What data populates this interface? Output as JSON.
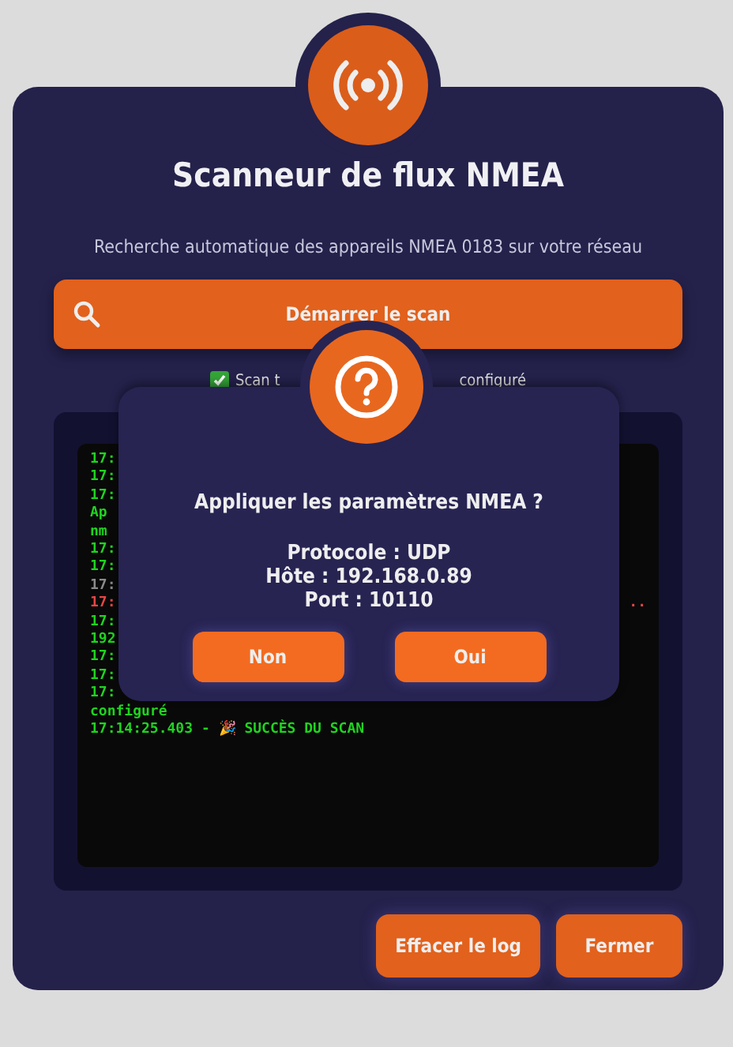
{
  "scanner": {
    "title": "Scanneur de flux NMEA",
    "subtitle": "Recherche automatique des appareils NMEA 0183 sur votre réseau",
    "scan_button": "Démarrer le scan",
    "option": {
      "checked": true,
      "label_start": "Scan t",
      "label_end": "configuré"
    },
    "log": [
      {
        "text": "17:",
        "kind": "ok"
      },
      {
        "text": "17:",
        "kind": "ok"
      },
      {
        "text": "17:",
        "kind": "ok"
      },
      {
        "text": "Ap",
        "kind": "ok"
      },
      {
        "text": "nm",
        "kind": "ok"
      },
      {
        "text": "17:",
        "kind": "ok"
      },
      {
        "text": "17:",
        "kind": "ok"
      },
      {
        "text": "17:",
        "kind": "muted"
      },
      {
        "text": "17:",
        "kind": "error",
        "tail": ".."
      },
      {
        "text": "17:",
        "kind": "ok"
      },
      {
        "text": "192",
        "kind": "ok"
      },
      {
        "text": "17:",
        "kind": "ok"
      },
      {
        "text": "17:",
        "kind": "ok"
      },
      {
        "text": "17:",
        "kind": "ok"
      },
      {
        "text": "configuré",
        "kind": "ok"
      },
      {
        "text": "17:14:25.403 - 🎉 SUCCÈS DU SCAN",
        "kind": "ok"
      }
    ],
    "buttons": [
      "Effacer le log",
      "Fermer"
    ]
  },
  "dialog": {
    "title": "Appliquer les paramètres NMEA ?",
    "details": [
      "Protocole : UDP",
      "Hôte : 192.168.0.89",
      "Port : 10110"
    ],
    "buttons": [
      "Non",
      "Oui"
    ]
  }
}
